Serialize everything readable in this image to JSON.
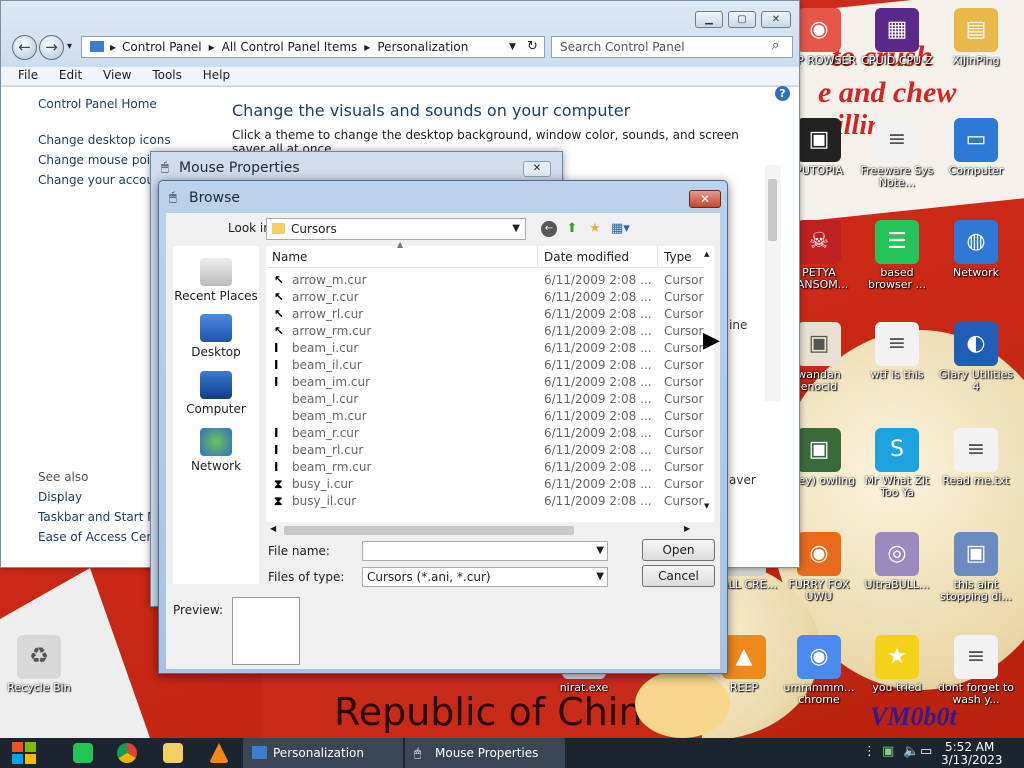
{
  "desktop": {
    "wallpaper_text": [
      "to crush",
      "e and chew",
      "illin"
    ],
    "wallpaper_caption": "Republic of China",
    "watermark": "VM0b0t",
    "icons_right": [
      {
        "label": "CCP ROWSER",
        "icon": "browser-icon",
        "color": "#e8564a"
      },
      {
        "label": "CPUID CPU-Z",
        "icon": "cpuz-icon",
        "color": "#5a2a8a"
      },
      {
        "label": "XiJinPing",
        "icon": "folder-icon",
        "color": "#e8b84a"
      },
      {
        "label": "PUTOPIA",
        "icon": "app-icon",
        "color": "#222222"
      },
      {
        "label": "Freeware Sys Note...",
        "icon": "document-icon",
        "color": "#f2f2f2"
      },
      {
        "label": "Computer",
        "icon": "computer-icon",
        "color": "#2d7ad6"
      },
      {
        "label": "PETYA RANSOM...",
        "icon": "skull-icon",
        "color": "#c02020"
      },
      {
        "label": "based browser ...",
        "icon": "chat-icon",
        "color": "#25c45a"
      },
      {
        "label": "Network",
        "icon": "network-icon",
        "color": "#2d7ad6"
      },
      {
        "label": "wandan enocid",
        "icon": "app-icon",
        "color": "#e8e0d0"
      },
      {
        "label": "wtf is this",
        "icon": "document-icon",
        "color": "#f2f2f2"
      },
      {
        "label": "Glary Utilities 4",
        "icon": "glary-icon",
        "color": "#1e5fb5"
      },
      {
        "label": "(they) owling",
        "icon": "app-icon",
        "color": "#3a6a3a"
      },
      {
        "label": "Mr What Zit Too Ya",
        "icon": "skype-icon",
        "color": "#1ea2e0"
      },
      {
        "label": "Read me.txt",
        "icon": "text-file-icon",
        "color": "#f2f2f2"
      },
      {
        "label": "FURRY FOX UWU",
        "icon": "firefox-icon",
        "color": "#e86a1a"
      },
      {
        "label": "UltraBULL...",
        "icon": "disc-icon",
        "color": "#9a8ac0"
      },
      {
        "label": "this aint stopping di...",
        "icon": "installer-icon",
        "color": "#6a8ac0"
      },
      {
        "label": "E ALL CRE...",
        "icon": "app-icon",
        "color": "#d0d0d0"
      },
      {
        "label": "REEP",
        "icon": "vlc-icon",
        "color": "#ef8a1a"
      },
      {
        "label": "ummmmm... chrome",
        "icon": "chrome-icon",
        "color": "#4a8af0"
      },
      {
        "label": "you tried",
        "icon": "star-icon",
        "color": "#f5d21a"
      },
      {
        "label": "dont forget to wash y...",
        "icon": "document-icon",
        "color": "#f2f2f2"
      },
      {
        "label": "nirat.exe",
        "icon": "app-icon",
        "color": "#dddddd"
      },
      {
        "label": "Recycle Bin",
        "icon": "recycle-bin-icon",
        "color": "#d8d8d8"
      }
    ]
  },
  "control_panel": {
    "address": [
      "Control Panel",
      "All Control Panel Items",
      "Personalization"
    ],
    "search_placeholder": "Search Control Panel",
    "menu": [
      "File",
      "Edit",
      "View",
      "Tools",
      "Help"
    ],
    "left_nav": [
      "Control Panel Home",
      "Change desktop icons",
      "Change mouse pointers",
      "Change your account picture"
    ],
    "see_also_title": "See also",
    "see_also": [
      "Display",
      "Taskbar and Start Menu",
      "Ease of Access Center"
    ],
    "heading": "Change the visuals and sounds on your computer",
    "subheading": "Click a theme to change the desktop background, window color, sounds, and screen saver all at once.",
    "fragment_right_1": "ine",
    "fragment_right_2": "aver"
  },
  "mouse_properties": {
    "title": "Mouse Properties"
  },
  "browse": {
    "title": "Browse",
    "look_in_label": "Look in:",
    "look_in_value": "Cursors",
    "places": [
      "Recent Places",
      "Desktop",
      "Computer",
      "Network"
    ],
    "columns": [
      "Name",
      "Date modified",
      "Type"
    ],
    "files": [
      {
        "name": "arrow_m.cur",
        "date": "6/11/2009 2:08 ...",
        "type": "Cursor",
        "glyph": "↖"
      },
      {
        "name": "arrow_r.cur",
        "date": "6/11/2009 2:08 ...",
        "type": "Cursor",
        "glyph": "↖"
      },
      {
        "name": "arrow_rl.cur",
        "date": "6/11/2009 2:08 ...",
        "type": "Cursor",
        "glyph": "↖"
      },
      {
        "name": "arrow_rm.cur",
        "date": "6/11/2009 2:08 ...",
        "type": "Cursor",
        "glyph": "↖"
      },
      {
        "name": "beam_i.cur",
        "date": "6/11/2009 2:08 ...",
        "type": "Cursor",
        "glyph": "I"
      },
      {
        "name": "beam_il.cur",
        "date": "6/11/2009 2:08 ...",
        "type": "Cursor",
        "glyph": "I"
      },
      {
        "name": "beam_im.cur",
        "date": "6/11/2009 2:08 ...",
        "type": "Cursor",
        "glyph": "I"
      },
      {
        "name": "beam_l.cur",
        "date": "6/11/2009 2:08 ...",
        "type": "Cursor",
        "glyph": ""
      },
      {
        "name": "beam_m.cur",
        "date": "6/11/2009 2:08 ...",
        "type": "Cursor",
        "glyph": ""
      },
      {
        "name": "beam_r.cur",
        "date": "6/11/2009 2:08 ...",
        "type": "Cursor",
        "glyph": "I"
      },
      {
        "name": "beam_rl.cur",
        "date": "6/11/2009 2:08 ...",
        "type": "Cursor",
        "glyph": "I"
      },
      {
        "name": "beam_rm.cur",
        "date": "6/11/2009 2:08 ...",
        "type": "Cursor",
        "glyph": "I"
      },
      {
        "name": "busy_i.cur",
        "date": "6/11/2009 2:08 ...",
        "type": "Cursor",
        "glyph": "⧗"
      },
      {
        "name": "busy_il.cur",
        "date": "6/11/2009 2:08 ...",
        "type": "Cursor",
        "glyph": "⧗"
      }
    ],
    "file_name_label": "File name:",
    "file_name_value": "",
    "files_of_type_label": "Files of type:",
    "files_of_type_value": "Cursors (*.ani, *.cur)",
    "open_label": "Open",
    "cancel_label": "Cancel",
    "preview_label": "Preview:"
  },
  "taskbar": {
    "tasks": [
      "Personalization",
      "Mouse Properties"
    ],
    "time": "5:52 AM",
    "date": "3/13/2023"
  }
}
